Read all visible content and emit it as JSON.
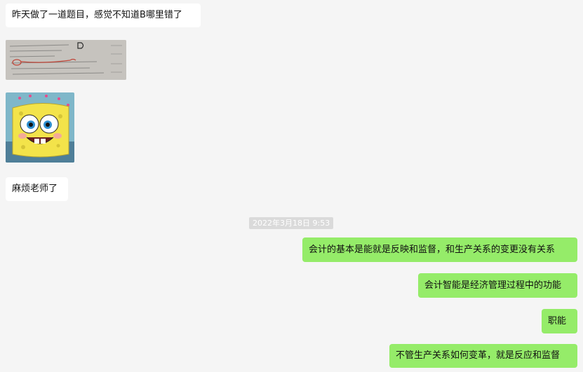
{
  "conversation": {
    "incoming": [
      {
        "text": "昨天做了一道题目，感觉不知道B哪里错了"
      },
      {
        "image": "exam-question-photo"
      },
      {
        "image": "spongebob-sticker"
      },
      {
        "text": "麻烦老师了"
      }
    ],
    "timestamp": "2022年3月18日 9:53",
    "outgoing": [
      {
        "text": "会计的基本是能就是反映和监督，和生产关系的变更没有关系"
      },
      {
        "text": "会计智能是经济管理过程中的功能"
      },
      {
        "text": "职能"
      },
      {
        "text": "不管生产关系如何变革，就是反应和监督"
      }
    ]
  },
  "colors": {
    "background": "#f5f5f5",
    "incoming_bubble": "#ffffff",
    "outgoing_bubble": "#95ec69",
    "timestamp_bg": "#dadada"
  }
}
